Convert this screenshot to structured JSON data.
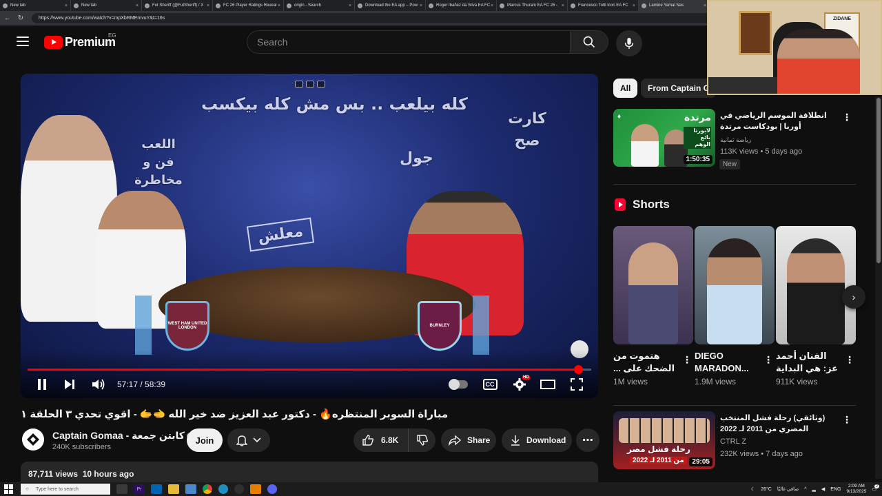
{
  "browser": {
    "tabs": [
      {
        "label": "New tab",
        "active": false
      },
      {
        "label": "New tab",
        "active": false
      },
      {
        "label": "Fut Sheriff (@FutSheriff) / X",
        "active": false
      },
      {
        "label": "FC 26 Player Ratings Reveal",
        "active": false
      },
      {
        "label": "origin - Search",
        "active": false
      },
      {
        "label": "Download the EA app – Pow",
        "active": false
      },
      {
        "label": "Roger Ibañez da Silva EA FC",
        "active": false
      },
      {
        "label": "Marcus Thuram EA FC 26 -",
        "active": false
      },
      {
        "label": "Francesco Totti Icon EA FC",
        "active": false
      },
      {
        "label": "Lamine Yamal Nas",
        "active": true
      }
    ],
    "url": "https://www.youtube.com/watch?v=mpXbRMEmvuY&t=16s"
  },
  "header": {
    "logo_text": "Premium",
    "region": "EG",
    "search_placeholder": "Search"
  },
  "player": {
    "current_time": "57:17",
    "duration": "58:39",
    "progress_fraction": 0.977,
    "overlay_text_1": "كله بيلعب .. بس مش كله بيكسب",
    "overlay_text_2": "اللعب فن و مخاطرة",
    "overlay_text_3": "جول",
    "overlay_text_4": "كارت صح",
    "overlay_text_5": "معلش",
    "crest_left": "WEST HAM UNITED",
    "crest_left_sub": "LONDON",
    "crest_right": "BURNLEY",
    "hd_badge": "HD",
    "cc_label": "CC"
  },
  "video": {
    "title": "مباراة السوبر المنتظره🔥 - دكتور عبد العزيز ضد خير الله 🫲🫱 - اقوي تحدي ٣ الحلقة ١",
    "channel": "Captain Gomaa - كابتن جمعة",
    "subscribers": "240K subscribers",
    "join_label": "Join",
    "likes": "6.8K",
    "share_label": "Share",
    "download_label": "Download",
    "views": "87,711 views",
    "uploaded": "10 hours ago"
  },
  "sidebar": {
    "chips": [
      {
        "label": "All",
        "active": true
      },
      {
        "label": "From Captain G",
        "active": false
      }
    ],
    "recommendations": [
      {
        "title": "انطلاقة الموسم الرياضي في أوربا | بودكاست مرتدة",
        "channel": "رياضة ثمانية",
        "meta": "113K views • 5 days ago",
        "duration": "1:50:35",
        "badge": "New",
        "thumb_text": "مرتدة",
        "thumb_sub": "لابورتا بائع الوهم"
      },
      {
        "title": "(وثائقي) رحلة فشل المنتخب المصري من 2011 لـ 2022",
        "channel": "CTRL Z",
        "meta": "232K views • 7 days ago",
        "duration": "29:05",
        "thumb_text": "رحلة فشل مصر",
        "thumb_sub": "من 2011 لـ 2022"
      }
    ],
    "shorts_title": "Shorts",
    "shorts": [
      {
        "title": "هتموت من الضحك على ...",
        "views": "1M views",
        "ltr": false
      },
      {
        "title": "DIEGO MARADON...",
        "views": "1.9M views",
        "ltr": true
      },
      {
        "title": "الفنان أحمد عز: هي البداية كدة ...",
        "views": "911K views",
        "ltr": false
      }
    ]
  },
  "webcam": {
    "poster_text": "ZIDANE"
  },
  "taskbar": {
    "search_placeholder": "Type here to search",
    "weather": "26°C",
    "weather_desc": "صافي غالبًا",
    "lang": "ENG",
    "time": "2:09 AM",
    "date": "9/13/2025",
    "notif_count": "2"
  },
  "colors": {
    "accent": "#ff0000",
    "background": "#0f0f0f",
    "surface": "#272727"
  }
}
